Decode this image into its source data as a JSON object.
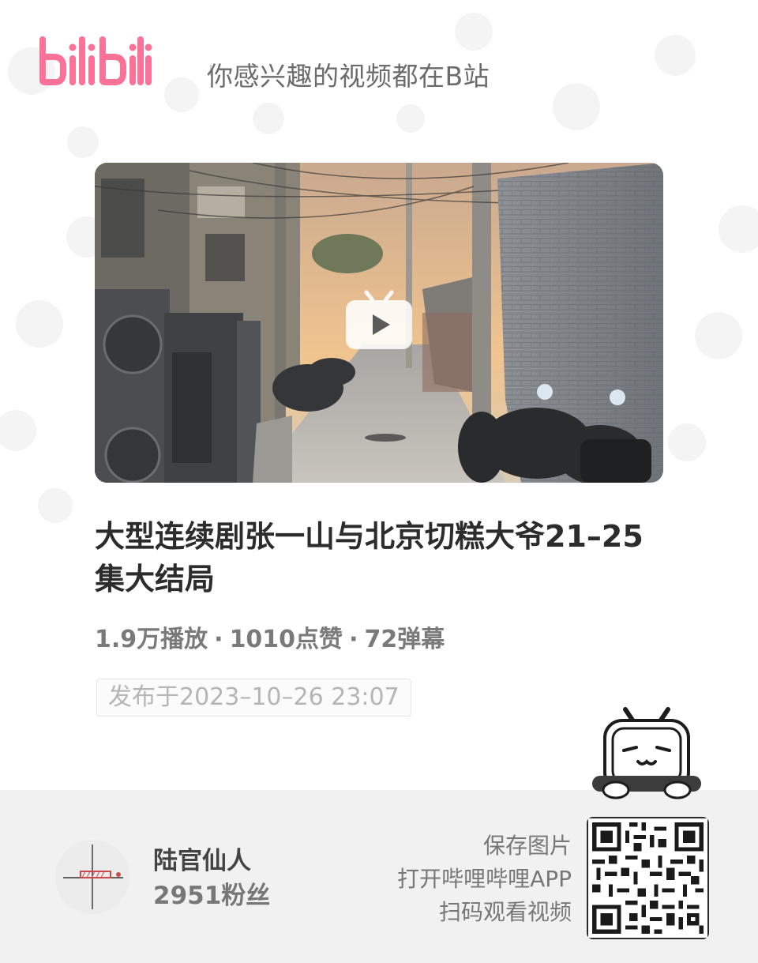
{
  "header": {
    "logo_text": "bilibili",
    "slogan": "你感兴趣的视频都在B站"
  },
  "video": {
    "title": "大型连续剧张一山与北京切糕大爷21–25集大结局",
    "views": "1.9万播放",
    "likes": "1010点赞",
    "danmaku": "72弹幕",
    "separator": "·",
    "publish_time": "发布于2023–10–26 23:07"
  },
  "uploader": {
    "name": "陆官仙人",
    "fans": "2951粉丝"
  },
  "share": {
    "line1": "保存图片",
    "line2": "打开哔哩哔哩APP",
    "line3": "扫码观看视频"
  },
  "colors": {
    "brand_pink": "#fb7299",
    "footer_bg": "#f1f1f1",
    "text_gray": "#7a7a7a"
  },
  "icons": {
    "play": "tv-play-icon",
    "mascot": "bilibili-tv-mascot-icon",
    "qr": "qr-code"
  }
}
